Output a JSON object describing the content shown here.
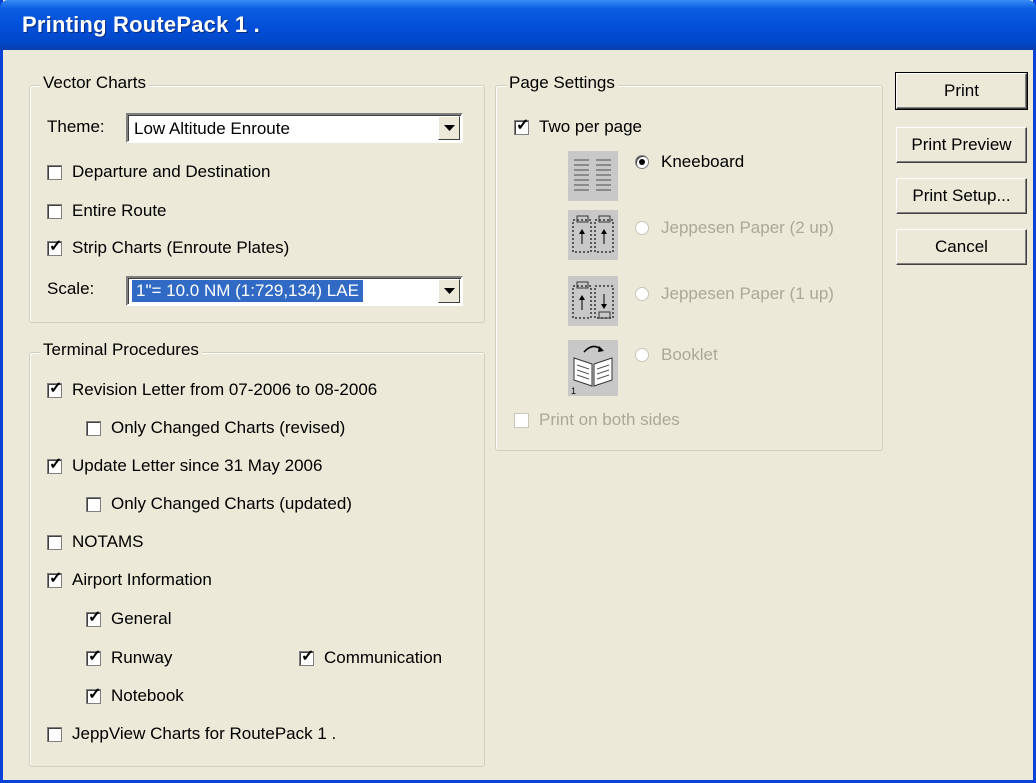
{
  "window": {
    "title": "Printing RoutePack 1 ."
  },
  "vector_charts": {
    "legend": "Vector Charts",
    "theme_label": "Theme:",
    "theme_value": "Low Altitude Enroute",
    "departure_destination": "Departure and Destination",
    "entire_route": "Entire Route",
    "strip_charts": "Strip Charts  (Enroute Plates)",
    "scale_label": "Scale:",
    "scale_value": "1\"= 10.0 NM  (1:729,134) LAE"
  },
  "terminal_procedures": {
    "legend": "Terminal Procedures",
    "revision_letter": "Revision Letter from 07-2006 to 08-2006",
    "only_changed_revised": "Only Changed Charts (revised)",
    "update_letter": "Update Letter since 31 May 2006",
    "only_changed_updated": "Only Changed Charts (updated)",
    "notams": "NOTAMS",
    "airport_information": "Airport Information",
    "general": "General",
    "runway": "Runway",
    "communication": "Communication",
    "notebook": "Notebook",
    "jeppview_charts": "JeppView Charts for RoutePack 1 ."
  },
  "page_settings": {
    "legend": "Page Settings",
    "two_per_page": "Two per page",
    "kneeboard": "Kneeboard",
    "jeppesen_2up": "Jeppesen Paper (2 up)",
    "jeppesen_1up": "Jeppesen Paper (1 up)",
    "booklet": "Booklet",
    "print_both_sides": "Print on both sides"
  },
  "buttons": {
    "print": "Print",
    "print_preview": "Print Preview",
    "print_setup": "Print Setup...",
    "cancel": "Cancel"
  },
  "colors": {
    "titlebar": "#0350d9",
    "dialog_bg": "#ece9d8",
    "selection": "#316ac5",
    "disabled_text": "#aca899"
  }
}
